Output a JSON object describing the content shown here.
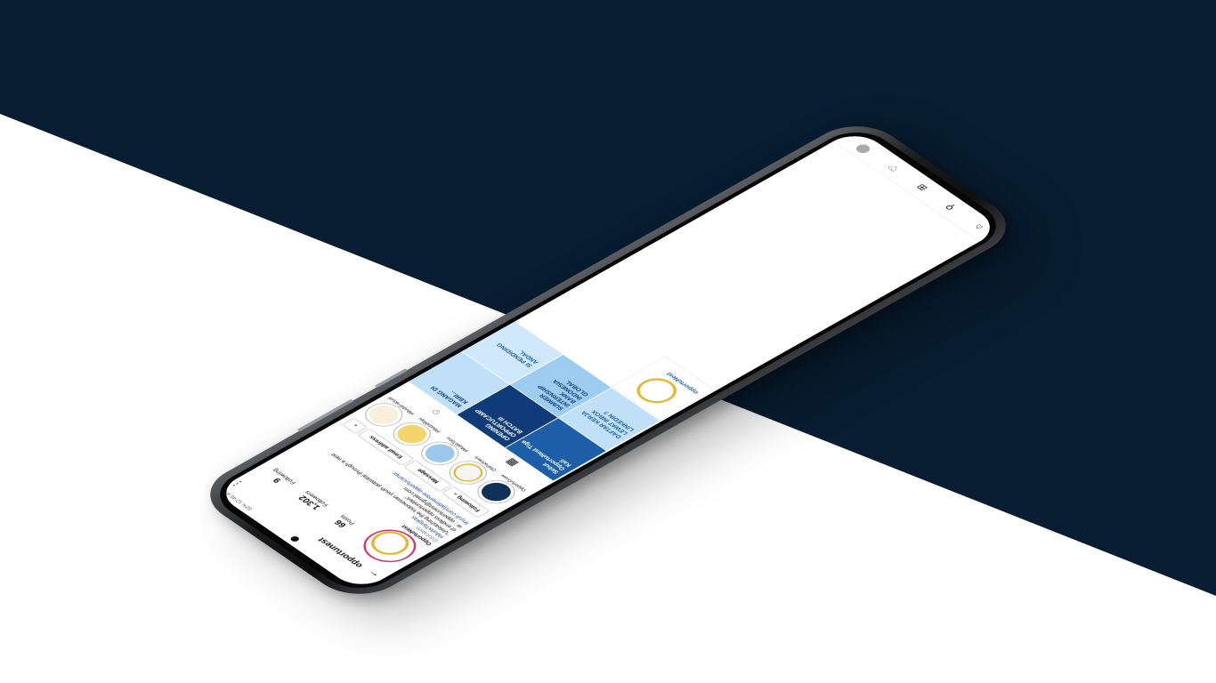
{
  "colors": {
    "navy": "#081d31",
    "white": "#ffffff",
    "accent": "#1b4a9c",
    "tile_blue": "#1c5fa8",
    "tile_light": "#bfe0f6",
    "gold": "#e3b93a"
  },
  "status_bar": {
    "text": "32% 12:46 am"
  },
  "header": {
    "username": "opportunest",
    "back_icon": "back-arrow-icon",
    "menu_icon": "more-vertical-icon"
  },
  "stats": [
    {
      "value": "66",
      "label": "Posts"
    },
    {
      "value": "1,302",
      "label": "Followers"
    },
    {
      "value": "9",
      "label": "Following"
    }
  ],
  "bio": {
    "name": "OpportuNest",
    "category": "Education",
    "hashtag": "#MudaTangkas",
    "line1": "\"Unleashing the Indonesian youth potential through a nest",
    "line2": "of endless opportunities\"",
    "email": "✉ : opportunest@gmail.com",
    "link": "linyuli.com/jadimentee-opportucamp/"
  },
  "buttons": {
    "following": "Following ⌄",
    "message": "Message",
    "email": "Email address",
    "more": "⌄"
  },
  "highlights": [
    {
      "label": "OpportuGrow"
    },
    {
      "label": "ONPartners"
    },
    {
      "label": "#MudaTahu"
    },
    {
      "label": "#MudaMaju"
    },
    {
      "label": "#MudaFaktual"
    }
  ],
  "tabs": {
    "grid_icon": "grid-icon",
    "tagged_icon": "tagged-icon"
  },
  "posts": [
    {
      "text": "Sebut OpportuNest Tiga Kali"
    },
    {
      "text": "OPENING OPPORTUCAMP BATCH III"
    },
    {
      "text": "MAGANG DI KBRI..."
    },
    {
      "text": "DAFTAR KERJA LEWAT INBOX LINKEDIN ?"
    },
    {
      "text": "SUMMER INTERNSHIP BANK INDONESIA GLOBAL"
    },
    {
      "text": "SI PENDIDING ANDAL"
    },
    {
      "text": "opportuNest"
    }
  ],
  "bottom_nav": {
    "home": "home-icon",
    "search": "search-icon",
    "add": "add-post-icon",
    "heart": "heart-icon",
    "profile": "profile-icon"
  }
}
